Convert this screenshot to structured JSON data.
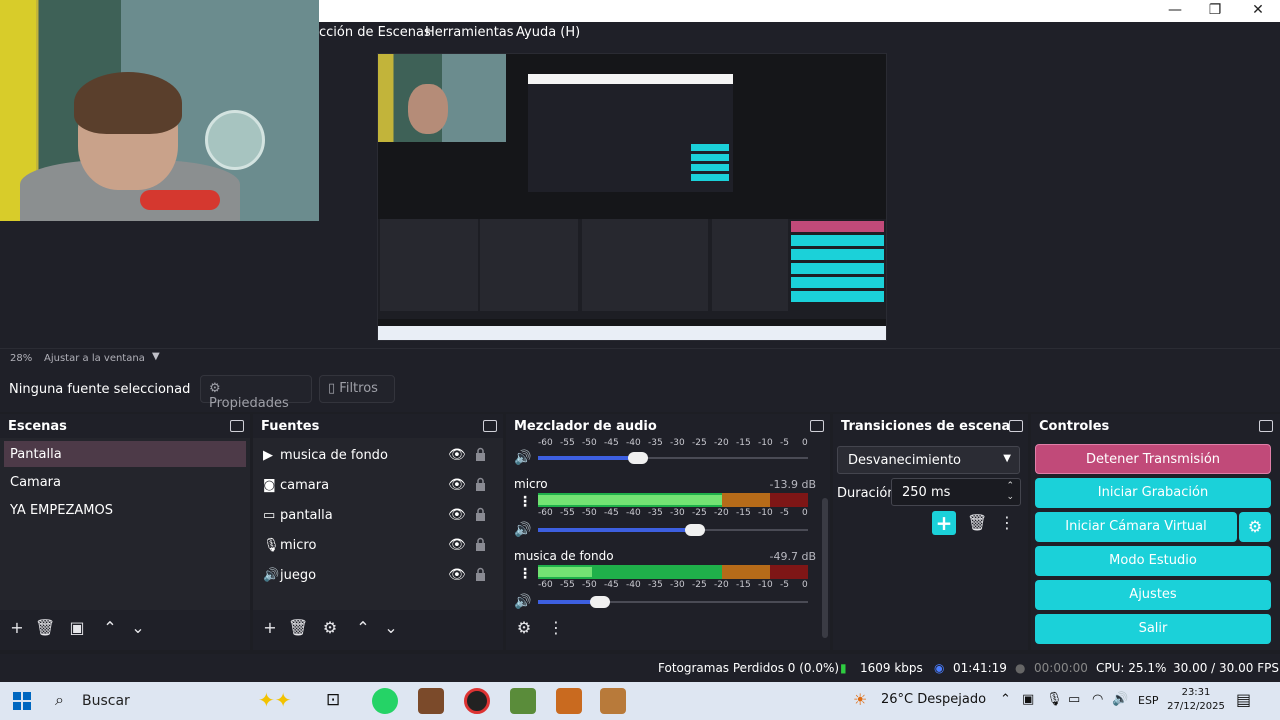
{
  "window": {
    "minimize": "—",
    "restore": "❐",
    "close": "✕"
  },
  "menu": {
    "items": [
      "cción de Escenas",
      "Herramientas",
      "Ayuda (H)"
    ]
  },
  "preview": {
    "zoom": "28%",
    "fit_label": "Ajustar a la ventana"
  },
  "source_toolbar": {
    "no_source": "Ninguna fuente seleccionad",
    "properties": "Propiedades",
    "filters": "Filtros"
  },
  "scenes": {
    "title": "Escenas",
    "items": [
      "Pantalla",
      "Camara",
      "YA EMPEZAMOS"
    ],
    "selected": "Pantalla"
  },
  "sources": {
    "title": "Fuentes",
    "items": [
      {
        "icon": "play-icon",
        "label": "musica de fondo"
      },
      {
        "icon": "camera-icon",
        "label": "camara"
      },
      {
        "icon": "monitor-icon",
        "label": "pantalla"
      },
      {
        "icon": "microphone-icon",
        "label": "micro"
      },
      {
        "icon": "speaker-icon",
        "label": "juego"
      }
    ]
  },
  "mixer": {
    "title": "Mezclador de audio",
    "scale": [
      "-60",
      "-55",
      "-50",
      "-45",
      "-40",
      "-35",
      "-30",
      "-25",
      "-20",
      "-15",
      "-10",
      "-5",
      "0"
    ],
    "channels": [
      {
        "name": "",
        "db": "",
        "volume": 0.37,
        "level": 0.0
      },
      {
        "name": "micro",
        "db": "-13.9 dB",
        "volume": 0.58,
        "level": 0.77
      },
      {
        "name": "musica de fondo",
        "db": "-49.7 dB",
        "volume": 0.23,
        "level": 0.2
      }
    ]
  },
  "transitions": {
    "title": "Transiciones de escena",
    "selected": "Desvanecimiento",
    "duration_label": "Duración",
    "duration": "250 ms"
  },
  "controls": {
    "title": "Controles",
    "stop_stream": "Detener Transmisión",
    "start_recording": "Iniciar Grabación",
    "start_virtual_cam": "Iniciar Cámara Virtual",
    "studio_mode": "Modo Estudio",
    "settings": "Ajustes",
    "exit": "Salir"
  },
  "status": {
    "dropped_frames": "Fotogramas Perdidos 0 (0.0%)",
    "bitrate": "1609 kbps",
    "stream_time": "01:41:19",
    "rec_time": "00:00:00",
    "cpu": "CPU: 25.1%",
    "fps": "30.00 / 30.00 FPS"
  },
  "taskbar": {
    "search": "Buscar",
    "weather": "26°C  Despejado",
    "lang": "ESP",
    "time": "23:31",
    "date": "27/12/2025"
  },
  "colors": {
    "accent": "#1bd1d9",
    "stop": "#c14a79",
    "selected_scene": "#4d3a48",
    "meter_green": "#1fb04a"
  }
}
